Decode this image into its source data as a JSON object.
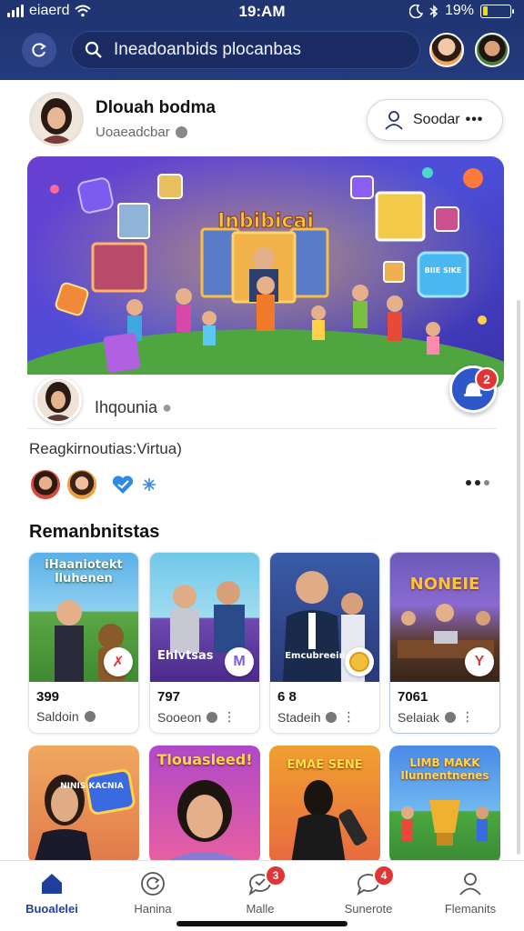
{
  "status_bar": {
    "carrier": "eiaerd",
    "time": "19:AM",
    "battery": "19%",
    "battery_level": 0.19
  },
  "header": {
    "search_text": "Ineadoanbids plocanbas"
  },
  "profile": {
    "name": "Dlouah bodma",
    "subtitle": "Uoaeadcbar",
    "action_label": "Soodar"
  },
  "hero": {
    "title": "Inbibicai",
    "sign_text": "BIIE SIKE",
    "creator_name": "Ihqounia",
    "notification_count": "2"
  },
  "post": {
    "caption": "Reagkirnoutias:Virtua)"
  },
  "section": {
    "title": "Remanbnitstas"
  },
  "cards": [
    {
      "thumb_title": "iHaaniotekt lluhenen",
      "number": "399",
      "meta": "Saldoin",
      "badge_icon": "heart-broken-icon"
    },
    {
      "thumb_title": "Ehlvtsas",
      "number": "797",
      "meta": "Sooeon",
      "badge_icon": "messenger-icon"
    },
    {
      "thumb_title": "Emcubreeinrals",
      "number": "6 8",
      "meta": "Stadeih",
      "badge_icon": "coin-icon"
    },
    {
      "thumb_title": "NONEIE",
      "number": "7061",
      "meta": "Selaiak",
      "badge_icon": "check-icon"
    }
  ],
  "cards_row2": [
    {
      "thumb_title": "NINIS KACNIA"
    },
    {
      "thumb_title": "Tlouasleed!"
    },
    {
      "thumb_title": "EMAE SENE"
    },
    {
      "thumb_title": "LIMB MAKK Ilunnentnenes"
    }
  ],
  "nav": [
    {
      "label": "Buoalelei",
      "icon": "home-icon"
    },
    {
      "label": "Hanina",
      "icon": "refresh-icon"
    },
    {
      "label": "Malle",
      "icon": "chat-icon",
      "badge": "3"
    },
    {
      "label": "Sunerote",
      "icon": "message-icon",
      "badge": "4"
    },
    {
      "label": "Flemanits",
      "icon": "profile-icon"
    }
  ],
  "colors": {
    "header_bg": "#223878",
    "accent": "#1f3f9e",
    "badge_red": "#e23434"
  }
}
